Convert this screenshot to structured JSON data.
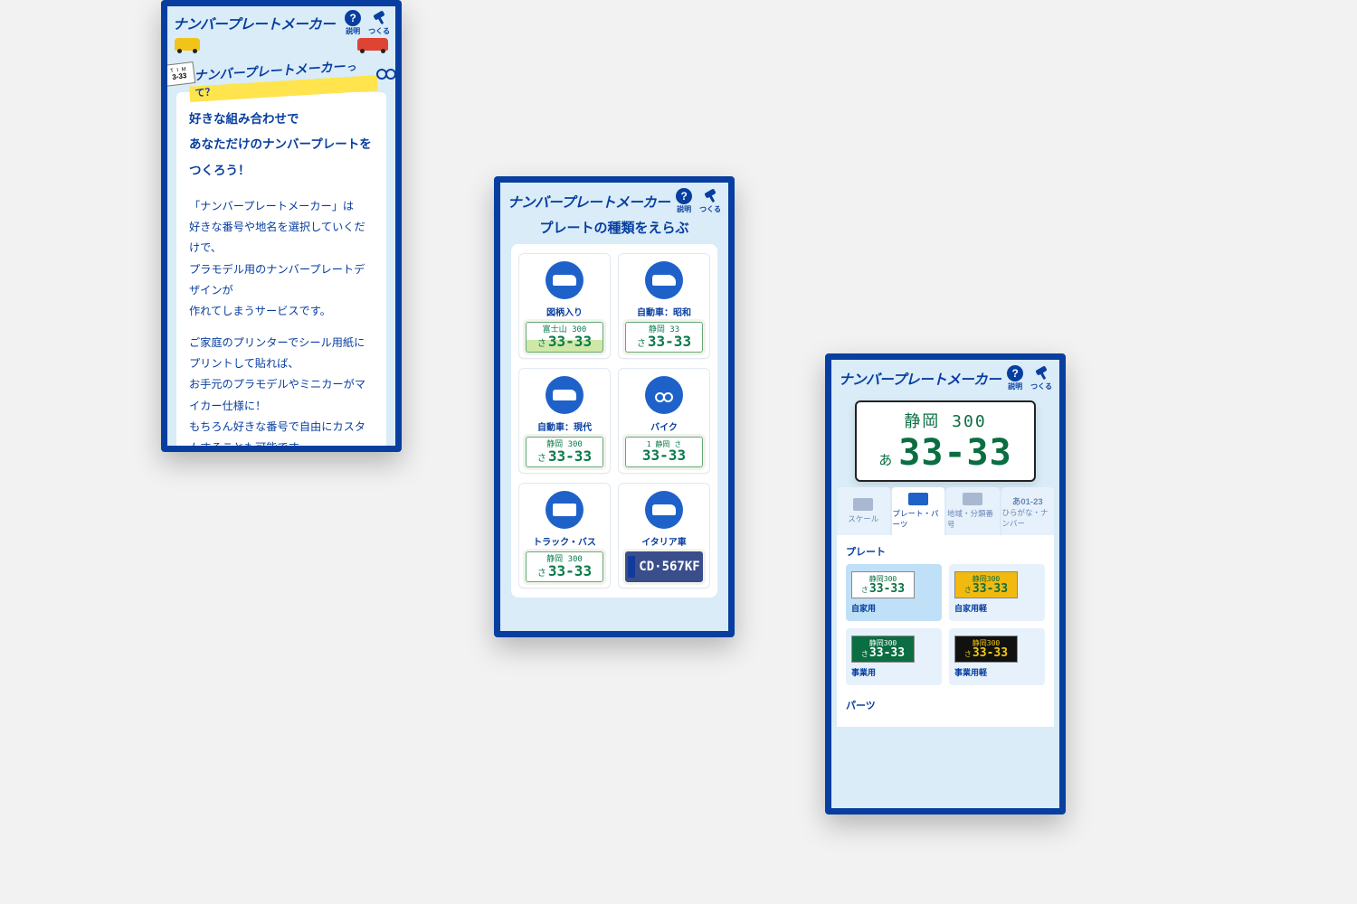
{
  "brand": "ナンバープレートメーカー",
  "topbar": {
    "help": "説明",
    "make": "つくる"
  },
  "p1": {
    "banner_label": "ナンバープレートメーカー",
    "banner_suffix": "って？",
    "mini_top": "T I M",
    "mini_bot": "3-33",
    "lead1": "好きな組み合わせで",
    "lead2": "あなただけのナンバープレートを",
    "lead3": "つくろう！",
    "para1a": "「ナンバープレートメーカー」は",
    "para1b": "好きな番号や地名を選択していくだけで、",
    "para1c": "プラモデル用のナンバープレートデザインが",
    "para1d": "作れてしまうサービスです。",
    "para2a": "ご家庭のプリンターでシール用紙にプリントして貼れば、",
    "para2b": "お手元のプラモデルやミニカーがマイカー仕様に！",
    "para2c": "もちろん好きな番号で自由にカスタムすることも可能です。"
  },
  "p2": {
    "title": "プレートの種類をえらぶ",
    "cards": {
      "c0": {
        "label": "図柄入り",
        "line1": "富士山 300",
        "line2": "33-33",
        "kana": "さ"
      },
      "c1": {
        "label": "自動車：昭和",
        "line1": "静岡 33",
        "line2": "33-33",
        "kana": "さ"
      },
      "c2": {
        "label": "自動車：現代",
        "line1": "静岡 300",
        "line2": "33-33",
        "kana": "さ"
      },
      "c3": {
        "label": "バイク",
        "line1": "1 静岡 さ",
        "line2": "33-33",
        "kana": ""
      },
      "c4": {
        "label": "トラック・バス",
        "line1": "静岡 300",
        "line2": "33-33",
        "kana": "さ"
      },
      "c5": {
        "label": "イタリア車",
        "line1": "",
        "line2": "CD·567KF",
        "kana": ""
      }
    }
  },
  "p3": {
    "big": {
      "line1": "静岡 300",
      "kana": "あ",
      "line2": "33-33"
    },
    "tabs": {
      "t0": "スケール",
      "t1": "プレート・パーツ",
      "t2": "地域・分類番号",
      "t3_sup": "あ01-23",
      "t3": "ひらがな・ナンバー"
    },
    "plate_section": "プレート",
    "swatches": {
      "s0": {
        "label": "自家用",
        "line1": "静岡300",
        "line2": "33-33",
        "kana": "さ"
      },
      "s1": {
        "label": "自家用軽",
        "line1": "静岡300",
        "line2": "33-33",
        "kana": "さ"
      },
      "s2": {
        "label": "事業用",
        "line1": "静岡300",
        "line2": "33-33",
        "kana": "さ"
      },
      "s3": {
        "label": "事業用軽",
        "line1": "静岡300",
        "line2": "33-33",
        "kana": "さ"
      }
    },
    "parts_section": "パーツ"
  }
}
